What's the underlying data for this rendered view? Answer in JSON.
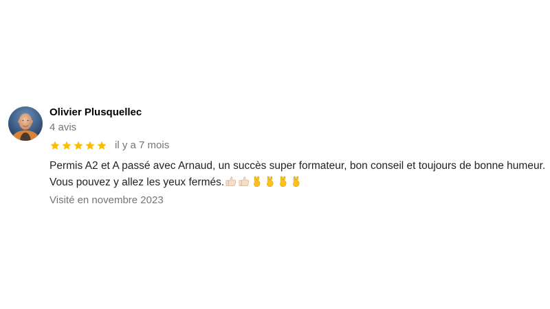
{
  "review": {
    "author": {
      "name": "Olivier Plusquellec",
      "review_count": "4 avis",
      "avatar": "avatar-photo"
    },
    "rating": {
      "stars": 5,
      "max_stars": 5,
      "star_icon": "star-icon",
      "star_color": "#fbbc04"
    },
    "date": "il y a 7 mois",
    "text": "Permis A2 et A passé avec Arnaud, un succès super formateur, bon conseil et toujours de bonne humeur. Vous pouvez y allez les yeux fermés.",
    "emojis": [
      "👍🏻",
      "👍🏻",
      "✌️",
      "✌️",
      "✌️",
      "✌️"
    ],
    "emoji_icons": [
      "thumbs-up-icon",
      "thumbs-up-icon",
      "victory-hand-icon",
      "victory-hand-icon",
      "victory-hand-icon",
      "victory-hand-icon"
    ],
    "visit": "Visité en novembre 2023"
  },
  "colors": {
    "name": "#000000",
    "secondary_text": "#70757a",
    "body_text": "#202124"
  }
}
